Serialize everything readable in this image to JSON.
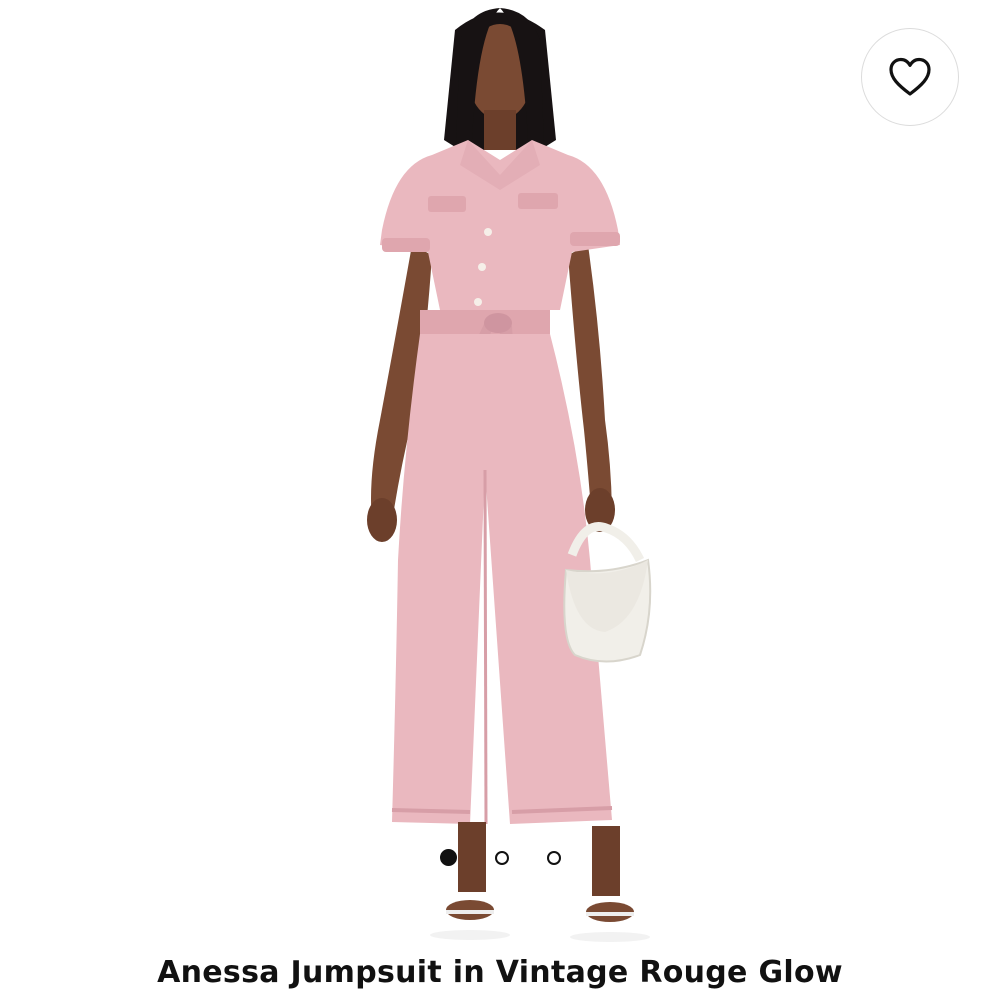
{
  "favorite": {
    "icon": "heart-outline-icon",
    "state": "not-favorited"
  },
  "carousel": {
    "total": 3,
    "active_index": 0
  },
  "product": {
    "title": "Anessa Jumpsuit in Vintage Rouge Glow",
    "image_alt": "Model wearing a pink short-sleeve denim jumpsuit with tie belt, holding a white handbag"
  },
  "colors": {
    "jumpsuit": "#eab8bf",
    "jumpsuit_shadow": "#d79ea7",
    "skin": "#7a4a33",
    "hair": "#171213",
    "bag": "#f1efe9",
    "dot_active": "#111111",
    "text": "#111111"
  }
}
